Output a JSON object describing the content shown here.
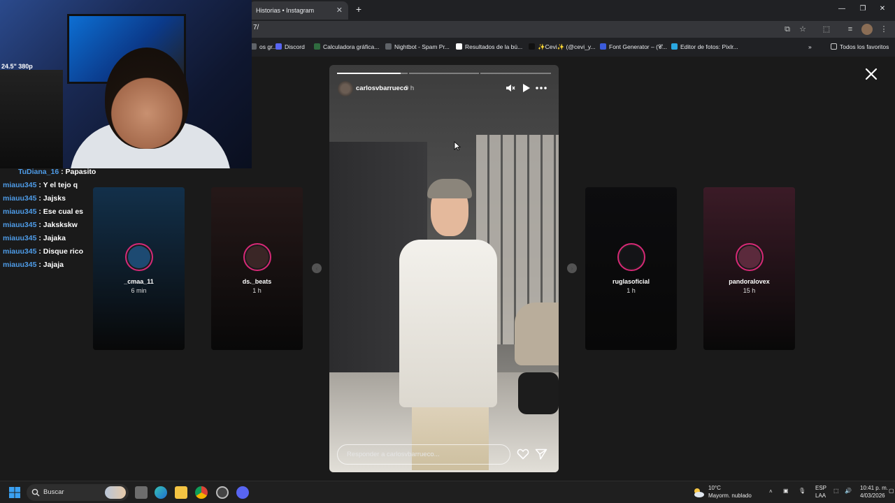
{
  "browser": {
    "tab_title": "Historias • Instagram",
    "tab_close": "✕",
    "new_tab": "+",
    "url_visible": "7/",
    "bookmarks": [
      {
        "label": "os gr...",
        "color": "#5f6368"
      },
      {
        "label": "Discord",
        "color": "#5865f2"
      },
      {
        "label": "Calculadora gráfica...",
        "color": "#2f6b3f"
      },
      {
        "label": "Nightbot - Spam Pr...",
        "color": "#5f6368"
      },
      {
        "label": "Resultados de la bú...",
        "color": "#ffffff"
      },
      {
        "label": "✨Cevi✨ (@cevi_y...",
        "color": "#111111"
      },
      {
        "label": "Font Generator – (𝓒...",
        "color": "#3b5bdb"
      },
      {
        "label": "Editor de fotos: Pixlr...",
        "color": "#2aa7e0"
      }
    ],
    "bookmarks_more": "»",
    "all_bookmarks": "Todos los favoritos"
  },
  "webcam": {
    "overlay_text": "24.5\" 380p"
  },
  "chat": [
    {
      "user": "TuDiana_16",
      "message": "Papasito"
    },
    {
      "user": "miauu345",
      "message": "Y el tejo q"
    },
    {
      "user": "miauu345",
      "message": "Jajsks"
    },
    {
      "user": "miauu345",
      "message": "Ese cual es"
    },
    {
      "user": "miauu345",
      "message": "Jakskskw"
    },
    {
      "user": "miauu345",
      "message": "Jajaka"
    },
    {
      "user": "miauu345",
      "message": "Disque rico"
    },
    {
      "user": "miauu345",
      "message": "Jajaja"
    }
  ],
  "stories": {
    "left": [
      {
        "name": "_cmaa_11",
        "time": "6 min",
        "bg": "#1d4a72"
      },
      {
        "name": "ds._beats",
        "time": "1 h",
        "bg": "#3a2626"
      }
    ],
    "right": [
      {
        "name": "ruglasoficial",
        "time": "1 h",
        "bg": "#141417"
      },
      {
        "name": "pandoralovex",
        "time": "15 h",
        "bg": "#5b2a3c"
      }
    ],
    "main": {
      "username": "carlosvbarrueco",
      "time": "9 h",
      "reply_placeholder": "Responder a carlosvbarrueco...",
      "segments_total": 3,
      "current_segment": 1,
      "current_segment_progress": 0.9
    }
  },
  "taskbar": {
    "search_placeholder": "Buscar",
    "weather_temp": "10°C",
    "weather_desc": "Mayorm. nublado",
    "lang_1": "ESP",
    "lang_2": "LAA",
    "time": "10:41 p. m.",
    "date": "4/03/2026"
  }
}
